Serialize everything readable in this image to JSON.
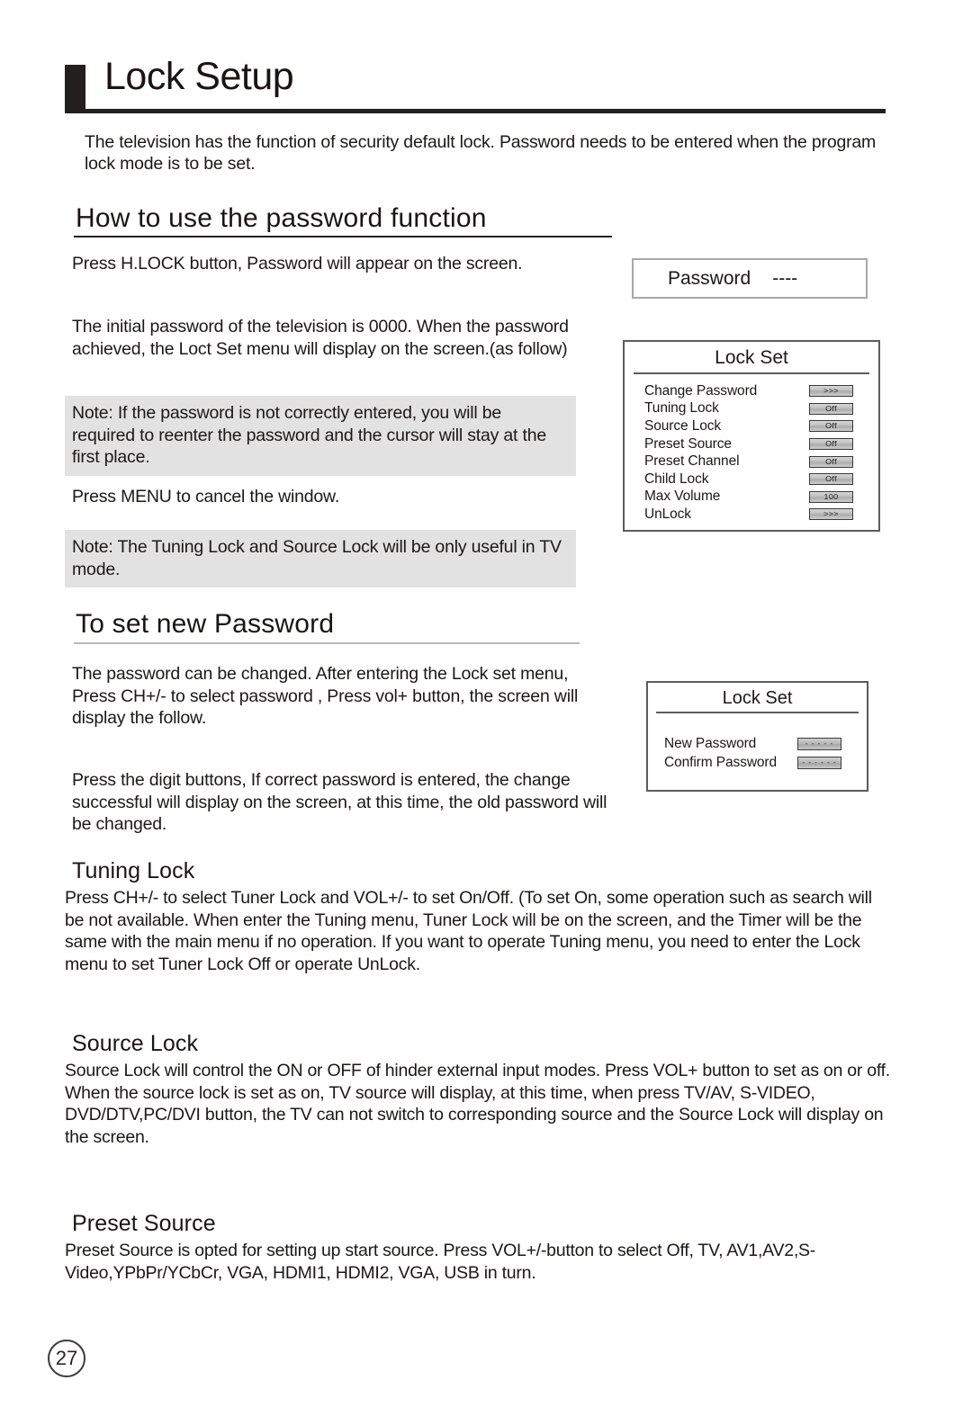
{
  "page": {
    "title": "Lock Setup",
    "number": "27",
    "intro": "The television has the function of security default lock. Password needs to be entered when the program lock mode is to be set."
  },
  "sections": {
    "howto": {
      "heading": "How to use the password function",
      "para_hlock": "Press H.LOCK button, Password will appear on the screen.",
      "para_initial": " The initial password of the television is 0000. When the password achieved, the Loct Set menu will display on the screen.(as follow)",
      "note_1": "Note: If the password is not correctly entered, you will be required to reenter the password and the cursor will stay at the first place.",
      "para_menu": "Press MENU to cancel the window.",
      "note_2": "Note: The Tuning Lock and Source Lock will be only useful in TV mode."
    },
    "setnew": {
      "heading": "To set new   Password",
      "para_canchange": "The password can be changed.     After entering the Lock set menu, Press CH+/- to select password , Press vol+ button, the screen will display the follow.",
      "para_digit": "Press the digit buttons, If correct password is entered, the change successful will display on the screen, at this time, the old password will be changed."
    },
    "tuning": {
      "heading": "Tuning Lock",
      "body": "Press CH+/- to select Tuner Lock and VOL+/- to set On/Off.  (To set On, some operation such as search will be not available. When enter the Tuning menu, Tuner Lock will be on the screen, and the Timer will be the same with the main menu if no operation. If you want to operate Tuning menu, you need to enter the Lock menu to set Tuner Lock Off or operate UnLock."
    },
    "source": {
      "heading": "Source Lock",
      "body": "Source Lock will control the ON or OFF of hinder external input modes. Press VOL+ button to set as on or off. When the source lock is set as on, TV source will display, at this time, when press TV/AV, S-VIDEO, DVD/DTV,PC/DVI button, the TV can not switch to corresponding source and the Source Lock will display on the screen."
    },
    "preset": {
      "heading": "Preset Source",
      "body": "Preset Source is opted for setting up start source. Press VOL+/-button to select Off, TV, AV1,AV2,S-Video,YPbPr/YCbCr, VGA, HDMI1, HDMI2, VGA, USB in turn."
    }
  },
  "osd": {
    "password_prompt": {
      "label": "Password",
      "value": "----"
    },
    "lock_set": {
      "title": "Lock Set",
      "rows": [
        {
          "label": "Change Password",
          "value": ">>>"
        },
        {
          "label": "Tuning Lock",
          "value": "Off"
        },
        {
          "label": "Source Lock",
          "value": "Off"
        },
        {
          "label": "Preset Source",
          "value": "Off"
        },
        {
          "label": "Preset Channel",
          "value": "Off"
        },
        {
          "label": "Child Lock",
          "value": "Off"
        },
        {
          "label": "Max Volume",
          "value": "100"
        },
        {
          "label": "UnLock",
          "value": ">>>"
        }
      ]
    },
    "lock_set_new": {
      "title": "Lock Set",
      "rows": [
        {
          "label": "New Password",
          "value": "- - - - -"
        },
        {
          "label": "Confirm Password",
          "value": "- - - - - -"
        }
      ]
    }
  },
  "colors": {
    "ink": "#1a1513",
    "note_bg": "#e2e2e2",
    "osd_border": "#5c5c5c",
    "chip_border": "#3a3a3a"
  }
}
